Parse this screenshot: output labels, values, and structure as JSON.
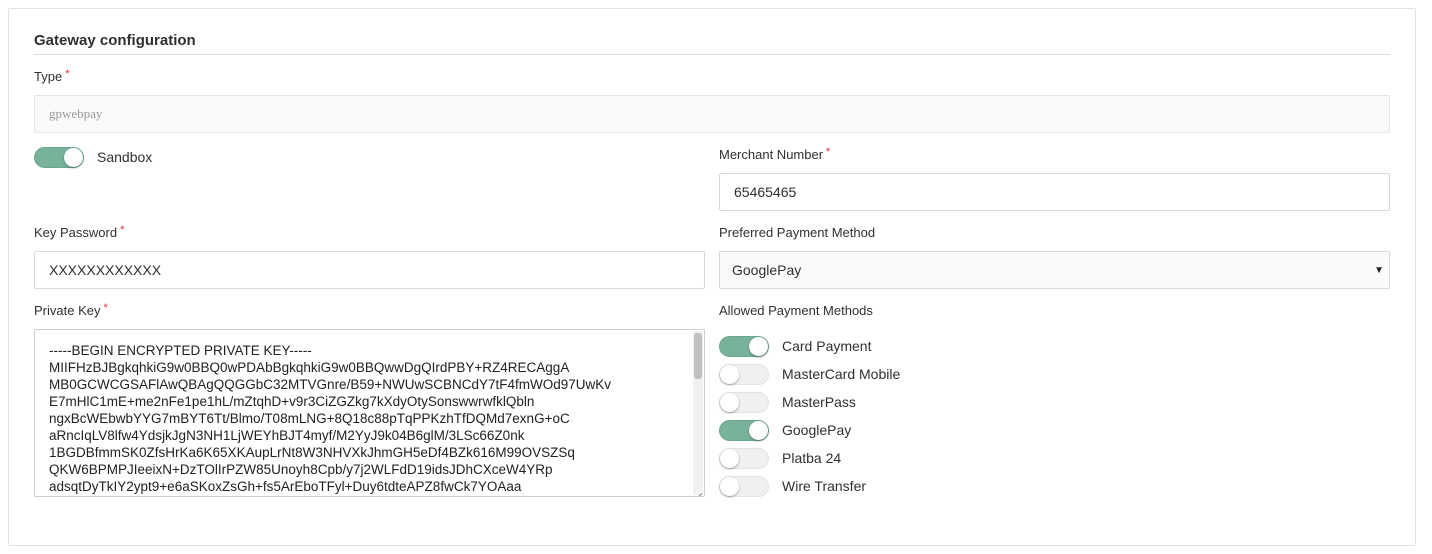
{
  "section": {
    "title": "Gateway configuration"
  },
  "type_field": {
    "label": "Type",
    "required": "*",
    "value": "gpwebpay"
  },
  "sandbox": {
    "label": "Sandbox",
    "checked": true
  },
  "merchant_number": {
    "label": "Merchant Number",
    "required": "*",
    "value": "65465465"
  },
  "key_password": {
    "label": "Key Password",
    "required": "*",
    "value": "XXXXXXXXXXXX"
  },
  "preferred_payment": {
    "label": "Preferred Payment Method",
    "value": "GooglePay"
  },
  "private_key": {
    "label": "Private Key",
    "required": "*",
    "value": "-----BEGIN ENCRYPTED PRIVATE KEY-----\nMIIFHzBJBgkqhkiG9w0BBQ0wPDAbBgkqhkiG9w0BBQwwDgQIrdPBY+RZ4RECAggA\nMB0GCWCGSAFlAwQBAgQQGGbC32MTVGnre/B59+NWUwSCBNCdY7tF4fmWOd97UwKv\nE7mHlC1mE+me2nFe1pe1hL/mZtqhD+v9r3CiZGZkg7kXdyOtySonswwrwfklQbln\nngxBcWEbwbYYG7mBYT6Tt/Blmo/T08mLNG+8Q18c88pTqPPKzhTfDQMd7exnG+oC\naRncIqLV8lfw4YdsjkJgN3NH1LjWEYhBJT4myf/M2YyJ9k04B6glM/3LSc66Z0nk\n1BGDBfmmSK0ZfsHrKa6K65XKAupLrNt8W3NHVXkJhmGH5eDf4BZk616M99OVSZSq\nQKW6BPMPJIeeixN+DzTOlIrPZW85Unoyh8Cpb/y7j2WLFdD19idsJDhCXceW4YRp\nadsqtDyTkIY2ypt9+e6aSKoxZsGh+fs5ArEboTFyl+Duy6tdteAPZ8fwCk7YOAaa"
  },
  "allowed_methods": {
    "label": "Allowed Payment Methods",
    "items": [
      {
        "label": "Card Payment",
        "checked": true
      },
      {
        "label": "MasterCard Mobile",
        "checked": false
      },
      {
        "label": "MasterPass",
        "checked": false
      },
      {
        "label": "GooglePay",
        "checked": true
      },
      {
        "label": "Platba 24",
        "checked": false
      },
      {
        "label": "Wire Transfer",
        "checked": false
      }
    ]
  },
  "colors": {
    "toggle_on": "#79b29a",
    "required": "#e02b27"
  }
}
